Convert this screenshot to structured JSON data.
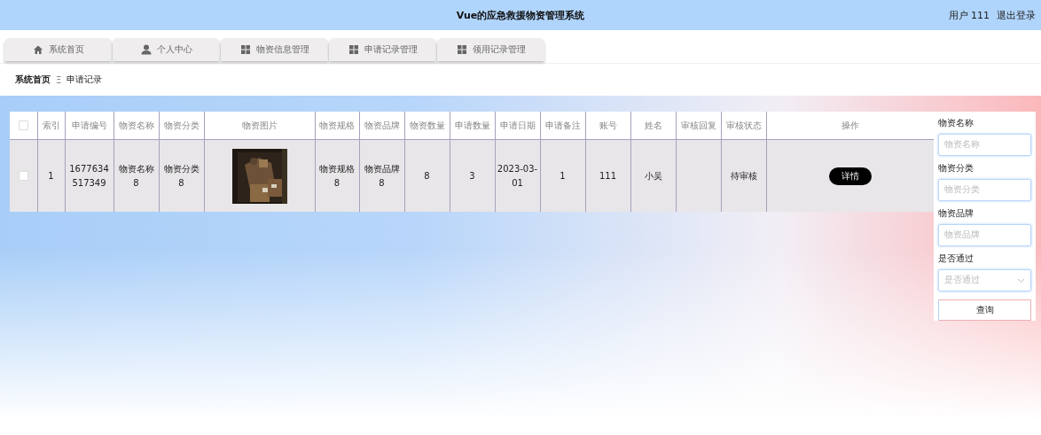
{
  "header": {
    "title": "Vue的应急救援物资管理系统",
    "user": "用户 111",
    "logout": "退出登录"
  },
  "tabs": [
    {
      "label": "系统首页",
      "kind": "home",
      "selected": false
    },
    {
      "label": "个人中心",
      "kind": "person",
      "selected": false
    },
    {
      "label": "物资信息管理",
      "kind": "grid",
      "selected": false
    },
    {
      "label": "申请记录管理",
      "kind": "grid",
      "selected": false
    },
    {
      "label": "领用记录管理",
      "kind": "grid",
      "selected": false
    }
  ],
  "breadcrumb": {
    "items": [
      "系统首页",
      "申请记录"
    ],
    "separator": "Ξ"
  },
  "table": {
    "select_all_checked": false,
    "columns": [
      "索引",
      "申请编号",
      "物资名称",
      "物资分类",
      "物资图片",
      "物资规格",
      "物资品牌",
      "物资数量",
      "申请数量",
      "申请日期",
      "申请备注",
      "账号",
      "姓名",
      "审核回复",
      "审核状态",
      "操作"
    ],
    "rows": [
      {
        "checked": false,
        "cells": [
          "1",
          "1677634517349",
          "物资名称8",
          "物资分类8",
          {
            "kind": "picture"
          },
          "物资规格8",
          "物资品牌8",
          "8",
          "3",
          "2023-03-01",
          "1",
          "111",
          "小吴",
          "",
          "待审核",
          {
            "kind": "button",
            "label": "详情"
          }
        ]
      }
    ]
  },
  "search": {
    "fields": [
      {
        "kind": "input",
        "label": "物资名称",
        "placeholder": "物资名称"
      },
      {
        "kind": "input",
        "label": "物资分类",
        "placeholder": "物资分类"
      },
      {
        "kind": "input",
        "label": "物资品牌",
        "placeholder": "物资品牌"
      },
      {
        "kind": "select",
        "label": "是否通过",
        "placeholder": "是否通过"
      }
    ],
    "button": "查询"
  }
}
